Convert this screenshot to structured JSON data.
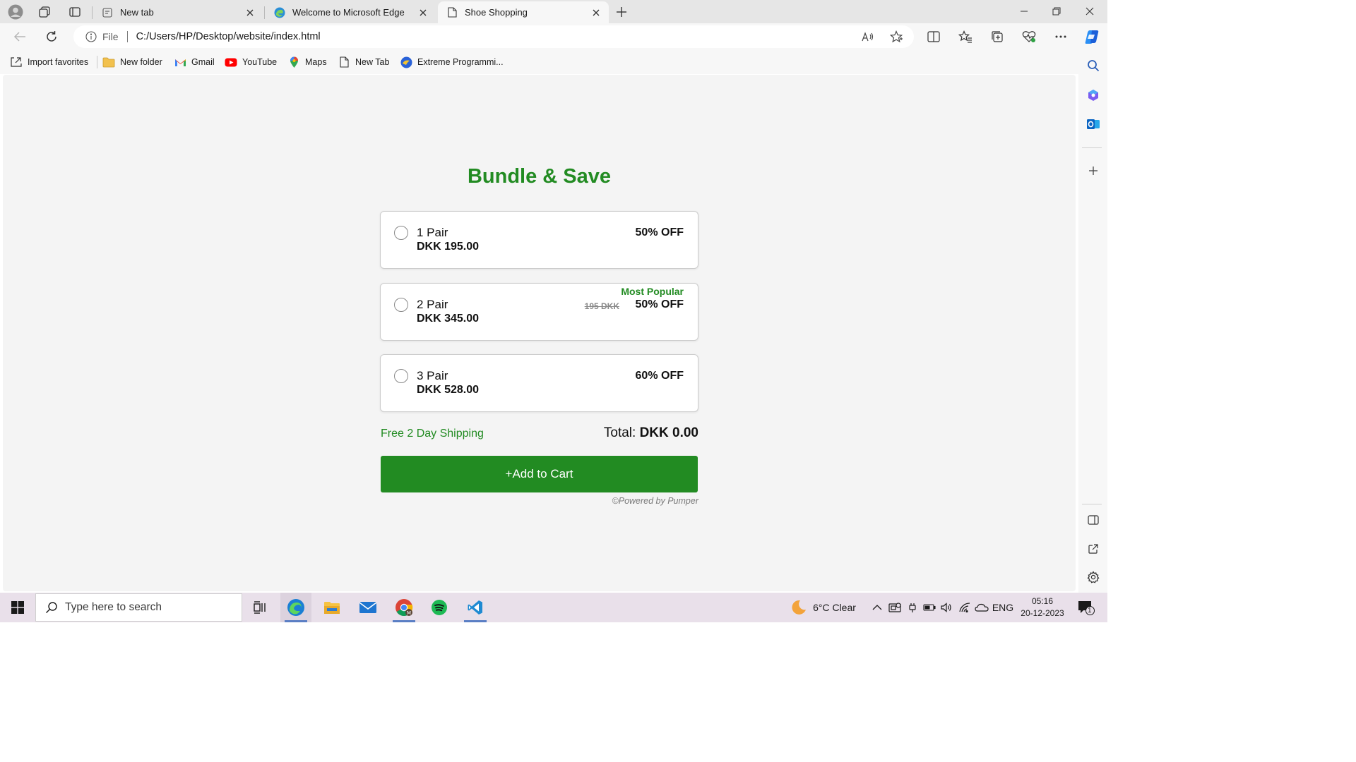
{
  "browser": {
    "tabs": [
      {
        "title": "New tab"
      },
      {
        "title": "Welcome to Microsoft Edge"
      },
      {
        "title": "Shoe Shopping"
      }
    ],
    "address": {
      "scheme": "File",
      "url": "C:/Users/HP/Desktop/website/index.html"
    },
    "favorites": [
      {
        "label": "Import favorites",
        "icon": "import-icon"
      },
      {
        "label": "New folder",
        "icon": "folder-icon"
      },
      {
        "label": "Gmail",
        "icon": "gmail-icon"
      },
      {
        "label": "YouTube",
        "icon": "youtube-icon"
      },
      {
        "label": "Maps",
        "icon": "maps-pin-icon"
      },
      {
        "label": "New Tab",
        "icon": "page-icon"
      },
      {
        "label": "Extreme Programmi...",
        "icon": "site-icon"
      }
    ]
  },
  "page": {
    "title": "Bundle & Save",
    "offers": [
      {
        "qty": "1 Pair",
        "price": "DKK 195.00",
        "discount": "50% OFF",
        "badge": "",
        "old_price": ""
      },
      {
        "qty": "2 Pair",
        "price": "DKK 345.00",
        "discount": "50% OFF",
        "badge": "Most Popular",
        "old_price": "195 DKK"
      },
      {
        "qty": "3 Pair",
        "price": "DKK 528.00",
        "discount": "60% OFF",
        "badge": "",
        "old_price": ""
      }
    ],
    "shipping": "Free 2 Day Shipping",
    "total_label": "Total:",
    "total_value": "DKK 0.00",
    "cart_button": "+Add to Cart",
    "powered": "©Powered by Pumper"
  },
  "taskbar": {
    "search_placeholder": "Type here to search",
    "weather": "6°C  Clear",
    "language": "ENG",
    "time": "05:16",
    "date": "20-12-2023",
    "notification_count": "1"
  },
  "colors": {
    "accent_green": "#228b22",
    "edge_blue": "#0f6cbd"
  }
}
